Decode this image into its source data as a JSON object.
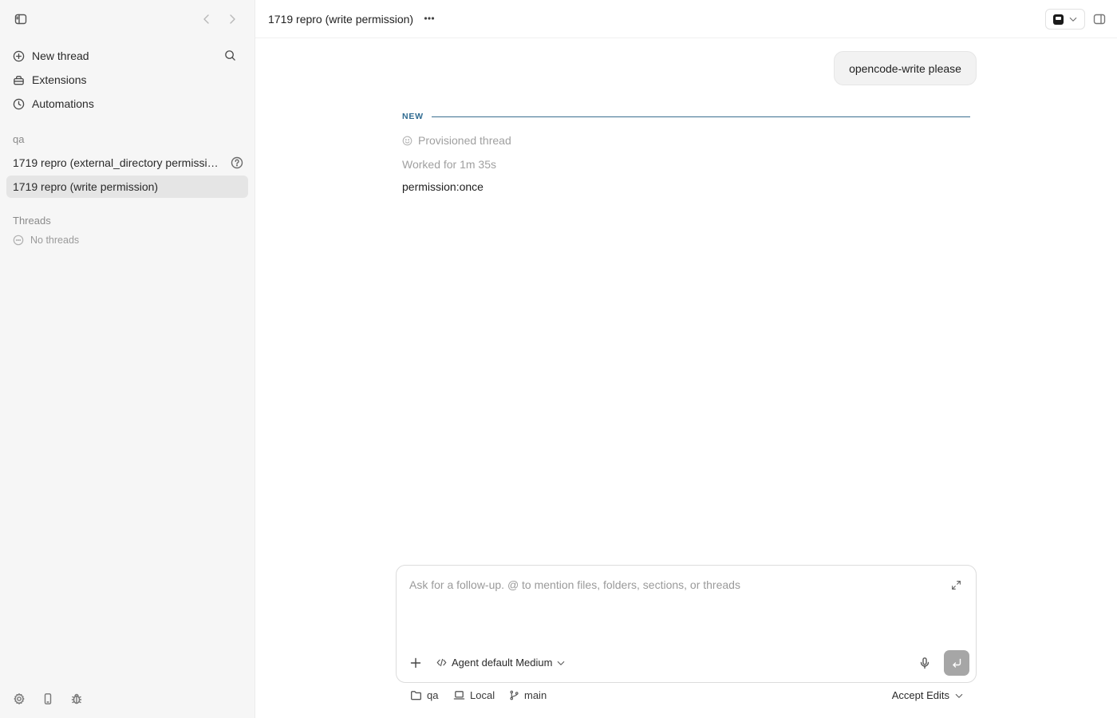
{
  "sidebar": {
    "menu": [
      {
        "label": "New thread",
        "icon": "plus-circle-icon"
      },
      {
        "label": "Extensions",
        "icon": "extensions-icon"
      },
      {
        "label": "Automations",
        "icon": "clock-icon"
      }
    ],
    "project_label": "qa",
    "project_threads": [
      {
        "label": "1719 repro (external_directory permissio...",
        "active": false
      },
      {
        "label": "1719 repro (write permission)",
        "active": true
      }
    ],
    "threads_label": "Threads",
    "no_threads_label": "No threads"
  },
  "header": {
    "title": "1719 repro (write permission)",
    "more_label": "···"
  },
  "conversation": {
    "user_message": "opencode-write please",
    "new_label": "NEW",
    "provisioned_label": "Provisioned thread",
    "worked_label": "Worked for 1m 35s",
    "output_text": "permission:once"
  },
  "composer": {
    "placeholder": "Ask for a follow-up. @ to mention files, folders, sections, or threads",
    "value": "",
    "agent_label": "Agent default Medium"
  },
  "footer": {
    "folder_label": "qa",
    "env_label": "Local",
    "branch_label": "main",
    "accept_label": "Accept Edits"
  },
  "colors": {
    "sidebar_bg": "#f6f6f6",
    "active_item_bg": "#e5e5e5",
    "accent_divider": "#2f6b91",
    "send_button": "#a6a6a6"
  }
}
